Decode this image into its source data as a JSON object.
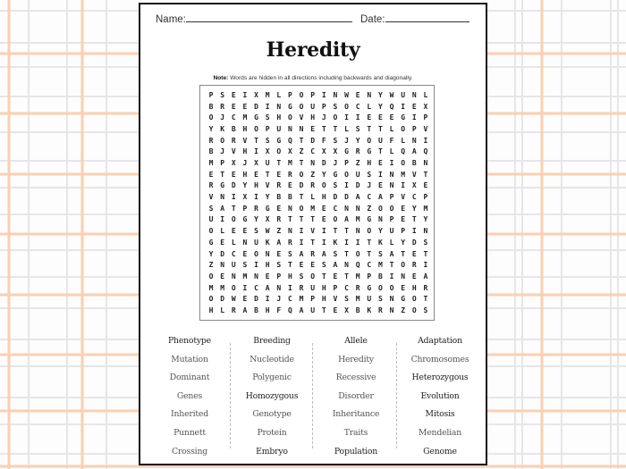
{
  "worksheet": {
    "name_label": "Name:",
    "date_label": "Date:",
    "title": "Heredity",
    "note_label": "Note:",
    "note_text": " Words are hidden in all directions including backwards and diagonally."
  },
  "grid": [
    "PSEIXMLPOPINWENYWUNL",
    "BREEDINGOUPSOCLYQIEX",
    "OJCMGSHOVHJOIIEEEGIP",
    "YKBHOPUNNETTLSTTLOPV",
    "RORVTSGQTDFSJYOUFLNI",
    "BJVHIXOXZCXXGRGTLQAQ",
    "MPXJXUTMTNDJPZHEIOBN",
    "ETEHETEROZYGOUSINMVT",
    "RGDYHVREDROSIDJENIXE",
    "VNIXIYBBTLHDDACAPVCP",
    "SATPRGENOMECNNZOOEYM",
    "UIOGYXRTTTEOAMGNPETY",
    "OLEESWZNIVITTNOYUPIN",
    "GELNUKARITIKIITKLYDS",
    "YDCEONESARASTOTSATET",
    "ZNUSIHSTEESANQCMTORI",
    "OENMNEPHSOTETMPBINEA",
    "MMOICANIRUHPCRGOOEHR",
    "ODWEDIJCMPHVSMUSNGOT",
    "HLRABHFQAUTEXBKRNZOS"
  ],
  "word_columns": [
    [
      "Phenotype",
      "Mutation",
      "Dominant",
      "Genes",
      "Inherited",
      "Punnett",
      "Crossing"
    ],
    [
      "Breeding",
      "Nucleotide",
      "Polygenic",
      "Homozygous",
      "Genotype",
      "Protein",
      "Embryo"
    ],
    [
      "Allele",
      "Heredity",
      "Recessive",
      "Disorder",
      "Inheritance",
      "Traits",
      "Population"
    ],
    [
      "Adaptation",
      "Chromosomes",
      "Heterozygous",
      "Evolution",
      "Mitosis",
      "Mendelian",
      "Genome"
    ]
  ],
  "emphasized_words": [
    "Phenotype",
    "Breeding",
    "Allele",
    "Adaptation",
    "Heterozygous",
    "Homozygous",
    "Evolution",
    "Mitosis",
    "Embryo",
    "Population",
    "Genome"
  ],
  "colors": {
    "plaid_orange": "#fccfb0",
    "plaid_gray": "#e6e6e9",
    "page_border": "#111111"
  }
}
